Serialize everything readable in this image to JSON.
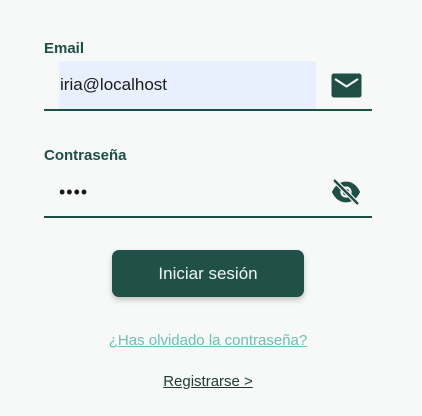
{
  "form": {
    "email": {
      "label": "Email",
      "value": "iria@localhost",
      "icon": "envelope-icon"
    },
    "password": {
      "label": "Contraseña",
      "value": "••••",
      "icon": "eye-slash-icon"
    },
    "submit_label": "Iniciar sesión",
    "forgot_label": "¿Has olvidado la contraseña?",
    "register_label": "Registrarse >"
  },
  "colors": {
    "primary": "#215048",
    "label": "#1f4e44",
    "link": "#6cc0b3",
    "autofill_bg": "#e8f0fe",
    "background": "#f7f8f8"
  }
}
